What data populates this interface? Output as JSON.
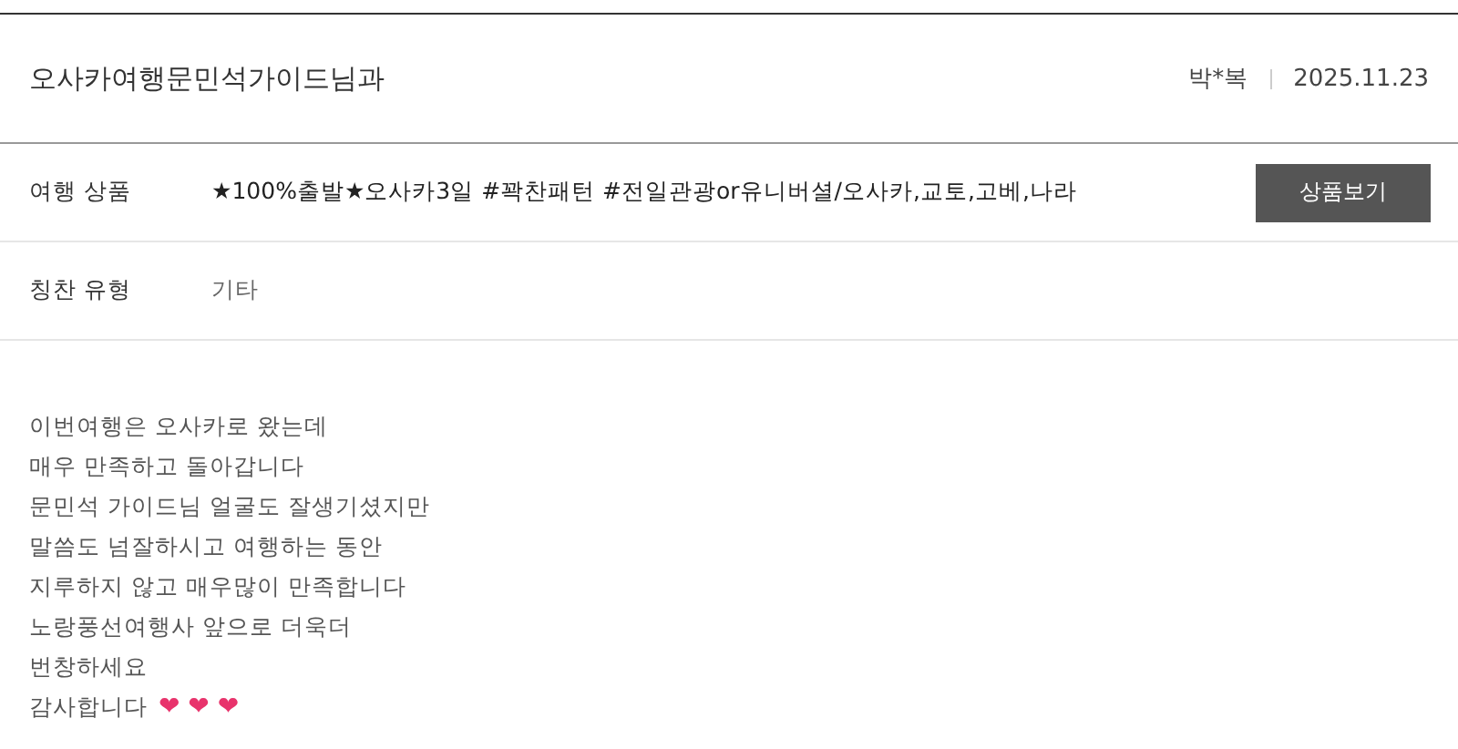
{
  "header": {
    "title": "오사카여행문민석가이드님과",
    "author": "박*복",
    "date": "2025.11.23"
  },
  "info_rows": [
    {
      "label": "여행 상품",
      "value": "★100%출발★오사카3일 #꽉찬패턴 #전일관광or유니버셜/오사카,교토,고베,나라",
      "button": "상품보기"
    },
    {
      "label": "칭찬 유형",
      "value": "기타"
    }
  ],
  "body": {
    "lines": [
      "이번여행은 오사카로 왔는데",
      "매우 만족하고 돌아갑니다",
      "문민석 가이드님 얼굴도 잘생기셨지만",
      "말씀도 넘잘하시고 여행하는 동안",
      "지루하지 않고 매우많이 만족합니다",
      "노랑풍선여행사 앞으로 더욱더",
      "번창하세요",
      "감사합니다"
    ],
    "hearts": "❤ ❤ ❤"
  }
}
